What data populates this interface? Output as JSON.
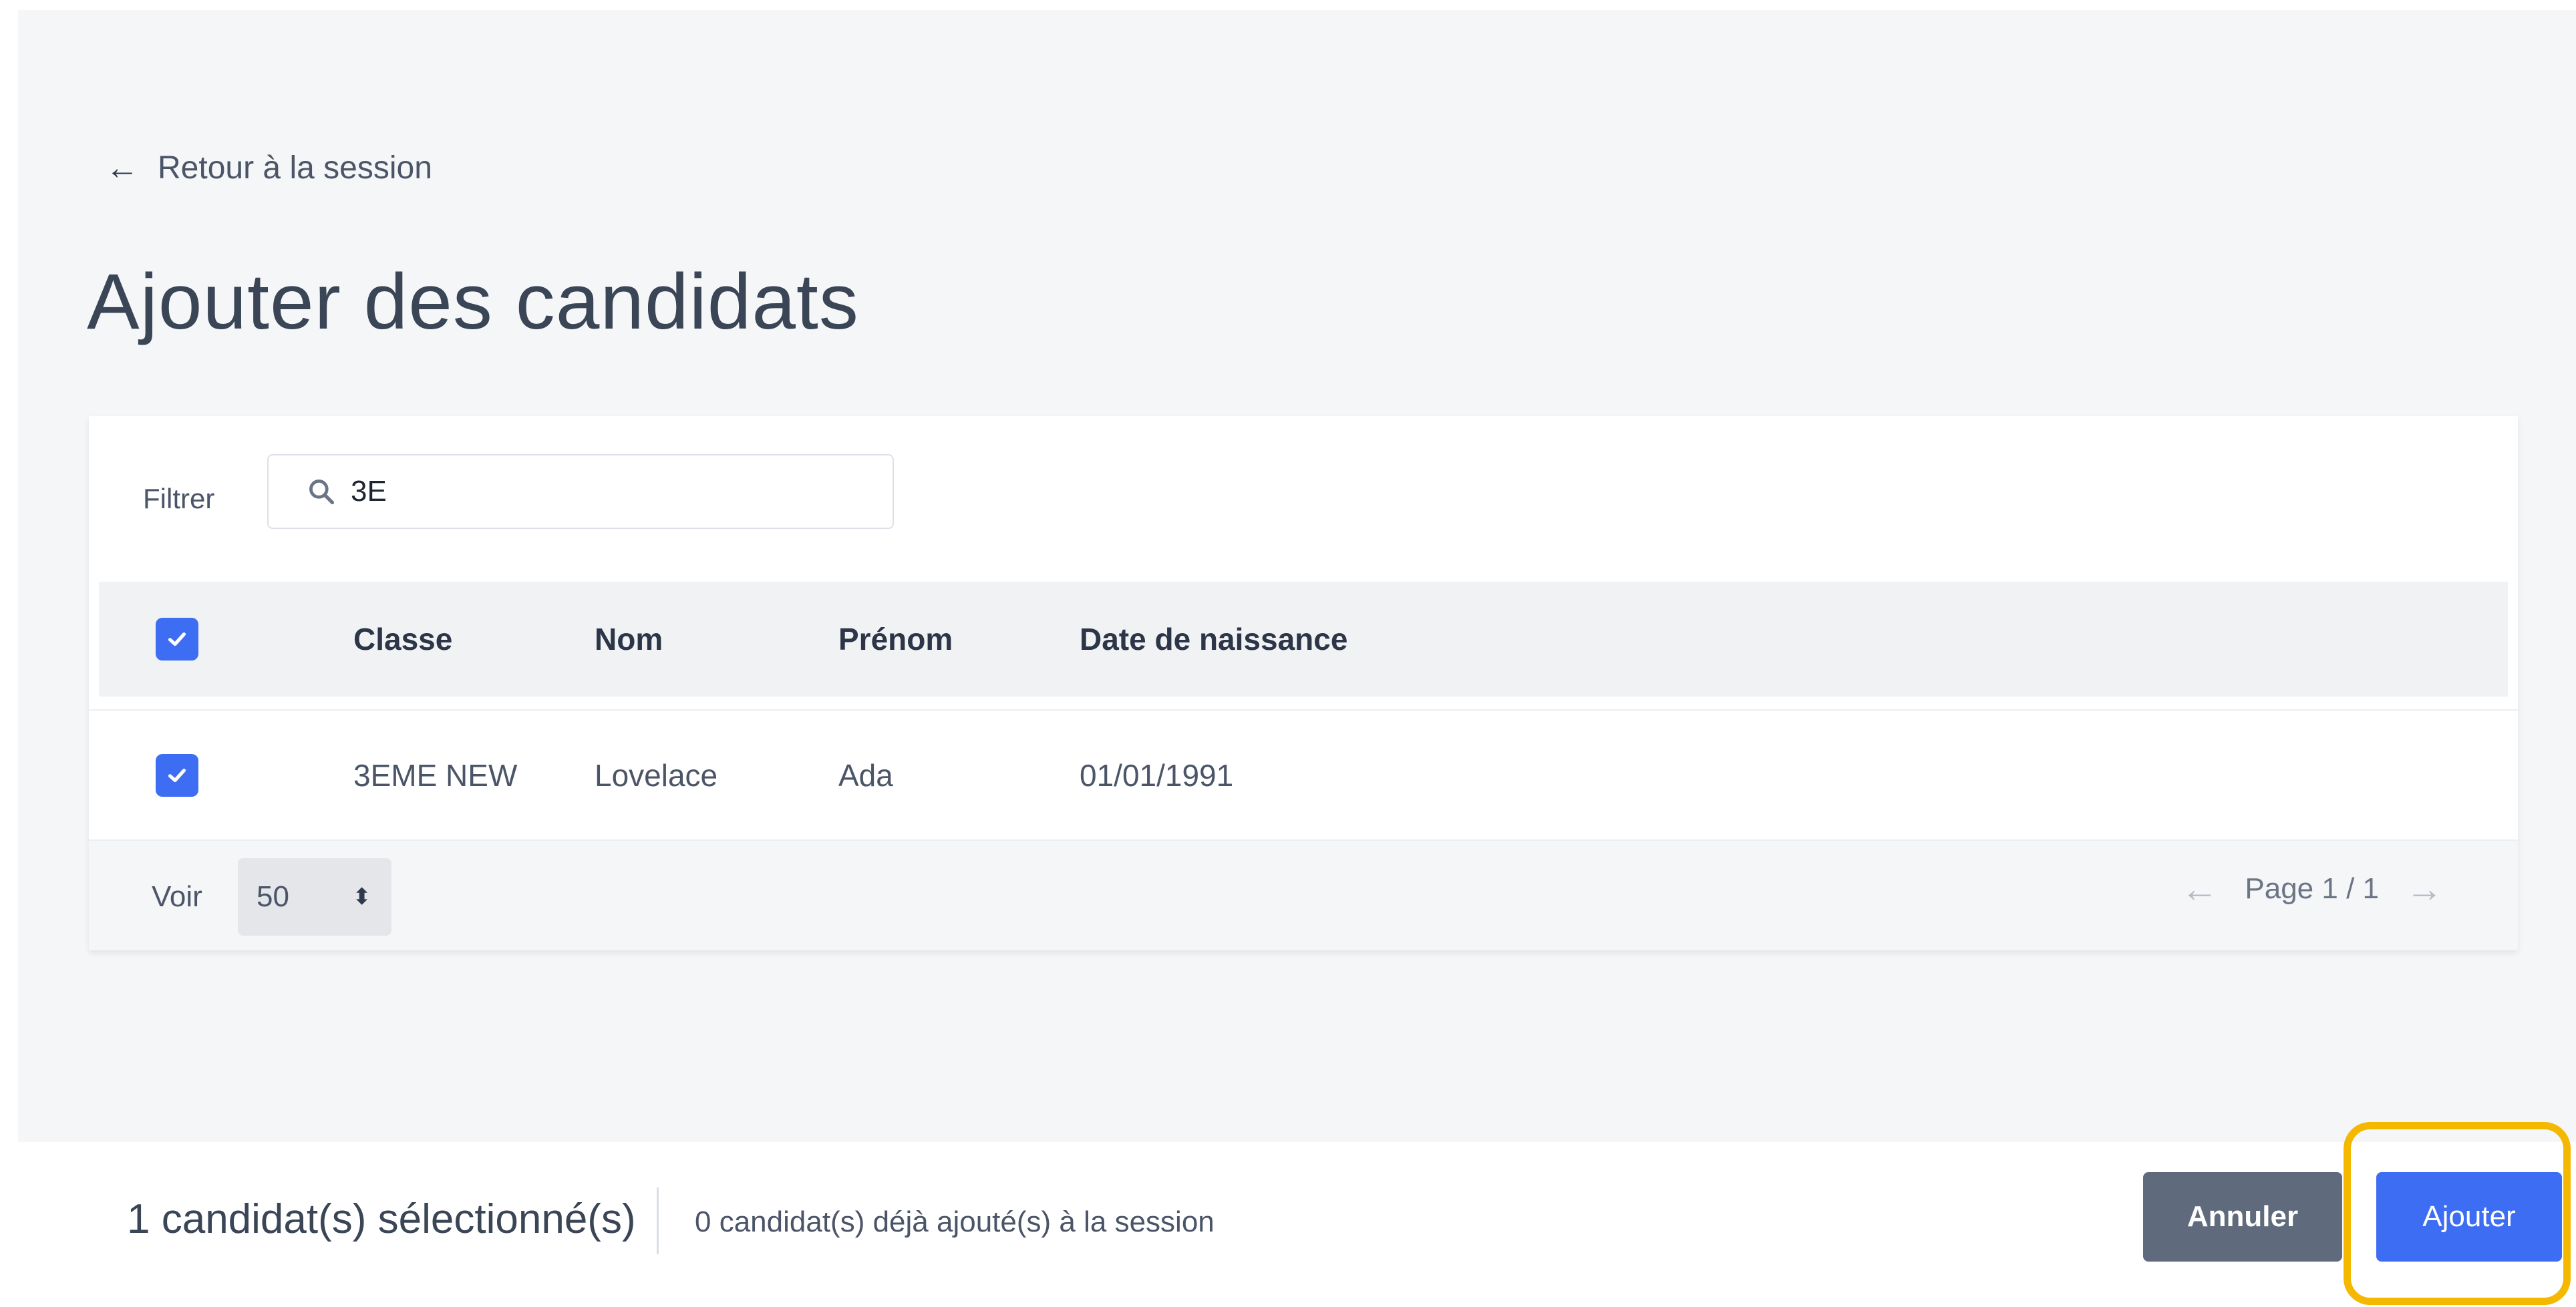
{
  "colors": {
    "accent": "#3d6df2",
    "cancel_button": "#5f6b7d",
    "highlight": "#f5b800",
    "page_background": "#f5f6f8"
  },
  "nav": {
    "back_label": "Retour à la session",
    "back_icon": "arrow-left-icon"
  },
  "page_title": "Ajouter des candidats",
  "filter": {
    "label": "Filtrer",
    "value": "3E",
    "icon": "search-icon"
  },
  "table": {
    "columns": [
      "Classe",
      "Nom",
      "Prénom",
      "Date de naissance"
    ],
    "header_checkbox_checked": true,
    "rows": [
      {
        "checked": true,
        "classe": "3EME NEW",
        "nom": "Lovelace",
        "prenom": "Ada",
        "date_naissance": "01/01/1991"
      }
    ]
  },
  "pagination": {
    "voir_label": "Voir",
    "per_page": "50",
    "page_text": "Page 1 / 1"
  },
  "footer": {
    "selected_count": "1 candidat(s) sélectionné(s)",
    "already_added": "0 candidat(s) déjà ajouté(s) à la session",
    "cancel_label": "Annuler",
    "add_label": "Ajouter"
  }
}
